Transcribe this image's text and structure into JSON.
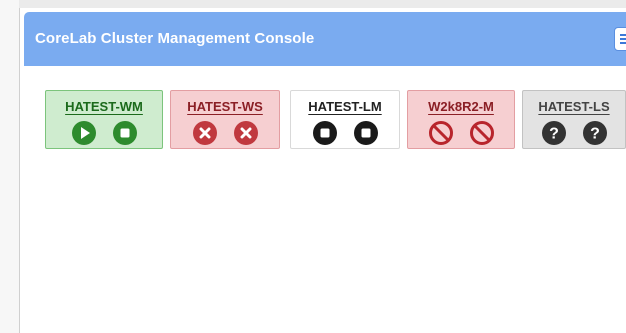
{
  "header": {
    "title": "CoreLab Cluster Management Console",
    "menu_icon": "hamburger-menu-icon",
    "color": "#7aabf0"
  },
  "nodes": [
    {
      "name": "HATEST-WM",
      "status": "running",
      "icons": [
        "play-icon",
        "stop-icon"
      ],
      "color": "#2e8b2e"
    },
    {
      "name": "HATEST-WS",
      "status": "failed",
      "icons": [
        "x-circle-icon",
        "x-circle-icon"
      ],
      "color": "#c0393f"
    },
    {
      "name": "HATEST-LM",
      "status": "stopped",
      "icons": [
        "stop-icon",
        "stop-icon"
      ],
      "color": "#1a1a1a"
    },
    {
      "name": "W2k8R2-M",
      "status": "disabled",
      "icons": [
        "no-entry-icon",
        "no-entry-icon"
      ],
      "color": "#b8252c"
    },
    {
      "name": "HATEST-LS",
      "status": "unknown",
      "icons": [
        "question-icon",
        "question-icon"
      ],
      "color": "#333333"
    }
  ]
}
